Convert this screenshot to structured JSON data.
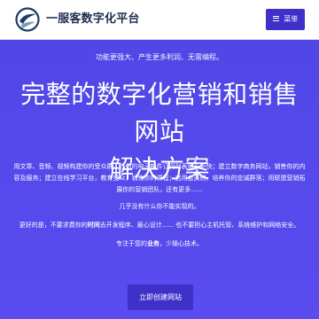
{
  "header": {
    "logo_text": "一服客数字化平台",
    "menu_label": "菜单",
    "colors": {
      "header_background": "#ffffff",
      "logo_text": "#1f2f4f",
      "logo_blue": "#1d3b66"
    }
  },
  "hero": {
    "tagline": "功能更强大、产生更多利润、无需编程。",
    "title_line_1": "完整的数字化营销和销售网站",
    "title_line_2": "解决方案",
    "description": "用文章、音频、视频构建你的受众群，让你的电子邮件订阅列表增长更快；建立数字商务网站，销售你的内容及服务；建立在线学习平台，教育受众，销售你的课程；启用会员制，培养你的忠诚群落；用联盟营销拓展你的营销团队，还有更多......",
    "question": "几乎没有什么你不能实现的。",
    "need_prefix": "更好的是，不要求费你的",
    "need_emphasis": "时间",
    "need_suffix": "去开发程序、雇心设计...... 也不要担心主机托管、系统维护和网络安全。",
    "focus_prefix": "专注于您的",
    "focus_emphasis": "业务",
    "focus_suffix": "，少操心技术。",
    "cta_label": "立即创建网站"
  },
  "theme": {
    "page_background": "#5646ea",
    "button_background": "#3f30c9",
    "text_color": "#ffffff"
  }
}
